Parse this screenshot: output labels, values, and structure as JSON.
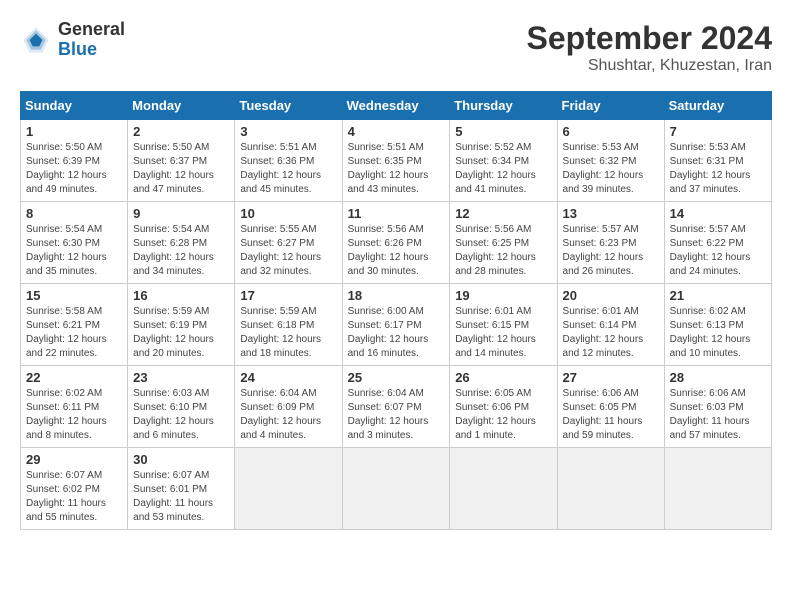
{
  "header": {
    "logo_general": "General",
    "logo_blue": "Blue",
    "month_title": "September 2024",
    "location": "Shushtar, Khuzestan, Iran"
  },
  "weekdays": [
    "Sunday",
    "Monday",
    "Tuesday",
    "Wednesday",
    "Thursday",
    "Friday",
    "Saturday"
  ],
  "days": [
    {
      "num": "",
      "info": ""
    },
    {
      "num": "1",
      "info": "Sunrise: 5:50 AM\nSunset: 6:39 PM\nDaylight: 12 hours\nand 49 minutes."
    },
    {
      "num": "2",
      "info": "Sunrise: 5:50 AM\nSunset: 6:37 PM\nDaylight: 12 hours\nand 47 minutes."
    },
    {
      "num": "3",
      "info": "Sunrise: 5:51 AM\nSunset: 6:36 PM\nDaylight: 12 hours\nand 45 minutes."
    },
    {
      "num": "4",
      "info": "Sunrise: 5:51 AM\nSunset: 6:35 PM\nDaylight: 12 hours\nand 43 minutes."
    },
    {
      "num": "5",
      "info": "Sunrise: 5:52 AM\nSunset: 6:34 PM\nDaylight: 12 hours\nand 41 minutes."
    },
    {
      "num": "6",
      "info": "Sunrise: 5:53 AM\nSunset: 6:32 PM\nDaylight: 12 hours\nand 39 minutes."
    },
    {
      "num": "7",
      "info": "Sunrise: 5:53 AM\nSunset: 6:31 PM\nDaylight: 12 hours\nand 37 minutes."
    },
    {
      "num": "8",
      "info": "Sunrise: 5:54 AM\nSunset: 6:30 PM\nDaylight: 12 hours\nand 35 minutes."
    },
    {
      "num": "9",
      "info": "Sunrise: 5:54 AM\nSunset: 6:28 PM\nDaylight: 12 hours\nand 34 minutes."
    },
    {
      "num": "10",
      "info": "Sunrise: 5:55 AM\nSunset: 6:27 PM\nDaylight: 12 hours\nand 32 minutes."
    },
    {
      "num": "11",
      "info": "Sunrise: 5:56 AM\nSunset: 6:26 PM\nDaylight: 12 hours\nand 30 minutes."
    },
    {
      "num": "12",
      "info": "Sunrise: 5:56 AM\nSunset: 6:25 PM\nDaylight: 12 hours\nand 28 minutes."
    },
    {
      "num": "13",
      "info": "Sunrise: 5:57 AM\nSunset: 6:23 PM\nDaylight: 12 hours\nand 26 minutes."
    },
    {
      "num": "14",
      "info": "Sunrise: 5:57 AM\nSunset: 6:22 PM\nDaylight: 12 hours\nand 24 minutes."
    },
    {
      "num": "15",
      "info": "Sunrise: 5:58 AM\nSunset: 6:21 PM\nDaylight: 12 hours\nand 22 minutes."
    },
    {
      "num": "16",
      "info": "Sunrise: 5:59 AM\nSunset: 6:19 PM\nDaylight: 12 hours\nand 20 minutes."
    },
    {
      "num": "17",
      "info": "Sunrise: 5:59 AM\nSunset: 6:18 PM\nDaylight: 12 hours\nand 18 minutes."
    },
    {
      "num": "18",
      "info": "Sunrise: 6:00 AM\nSunset: 6:17 PM\nDaylight: 12 hours\nand 16 minutes."
    },
    {
      "num": "19",
      "info": "Sunrise: 6:01 AM\nSunset: 6:15 PM\nDaylight: 12 hours\nand 14 minutes."
    },
    {
      "num": "20",
      "info": "Sunrise: 6:01 AM\nSunset: 6:14 PM\nDaylight: 12 hours\nand 12 minutes."
    },
    {
      "num": "21",
      "info": "Sunrise: 6:02 AM\nSunset: 6:13 PM\nDaylight: 12 hours\nand 10 minutes."
    },
    {
      "num": "22",
      "info": "Sunrise: 6:02 AM\nSunset: 6:11 PM\nDaylight: 12 hours\nand 8 minutes."
    },
    {
      "num": "23",
      "info": "Sunrise: 6:03 AM\nSunset: 6:10 PM\nDaylight: 12 hours\nand 6 minutes."
    },
    {
      "num": "24",
      "info": "Sunrise: 6:04 AM\nSunset: 6:09 PM\nDaylight: 12 hours\nand 4 minutes."
    },
    {
      "num": "25",
      "info": "Sunrise: 6:04 AM\nSunset: 6:07 PM\nDaylight: 12 hours\nand 3 minutes."
    },
    {
      "num": "26",
      "info": "Sunrise: 6:05 AM\nSunset: 6:06 PM\nDaylight: 12 hours\nand 1 minute."
    },
    {
      "num": "27",
      "info": "Sunrise: 6:06 AM\nSunset: 6:05 PM\nDaylight: 11 hours\nand 59 minutes."
    },
    {
      "num": "28",
      "info": "Sunrise: 6:06 AM\nSunset: 6:03 PM\nDaylight: 11 hours\nand 57 minutes."
    },
    {
      "num": "29",
      "info": "Sunrise: 6:07 AM\nSunset: 6:02 PM\nDaylight: 11 hours\nand 55 minutes."
    },
    {
      "num": "30",
      "info": "Sunrise: 6:07 AM\nSunset: 6:01 PM\nDaylight: 11 hours\nand 53 minutes."
    },
    {
      "num": "",
      "info": ""
    },
    {
      "num": "",
      "info": ""
    },
    {
      "num": "",
      "info": ""
    },
    {
      "num": "",
      "info": ""
    },
    {
      "num": "",
      "info": ""
    }
  ]
}
